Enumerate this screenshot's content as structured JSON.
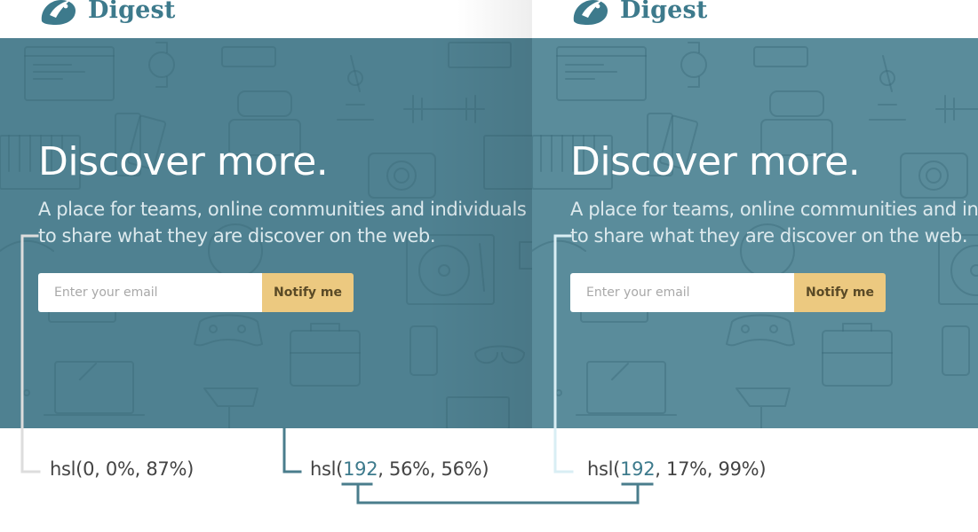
{
  "brand": {
    "name": "Digest"
  },
  "hero": {
    "headline": "Discover more.",
    "subtext_line1": "A place for teams, online communities and individuals",
    "subtext_line2": "to share what they are discover on the web."
  },
  "form": {
    "email_placeholder": "Enter your email",
    "button_label": "Notify me"
  },
  "annotations": {
    "text_color": {
      "prefix": "hsl(",
      "value": "0, 0%, 87%)"
    },
    "background_color_left": {
      "prefix": "hsl(",
      "hue": "192",
      "rest": ", 56%, 56%)"
    },
    "background_color_right": {
      "prefix": "hsl(",
      "hue": "192",
      "rest": ", 17%, 99%)"
    }
  },
  "colors": {
    "brand": "#3d7a8c",
    "hero_left": "#4f8191",
    "hero_right": "#5a8c9b",
    "button": "#ecc980",
    "annotation_line": "#4a7d8c"
  },
  "icons": [
    "logo-mark-icon",
    "background-pattern-icons"
  ]
}
